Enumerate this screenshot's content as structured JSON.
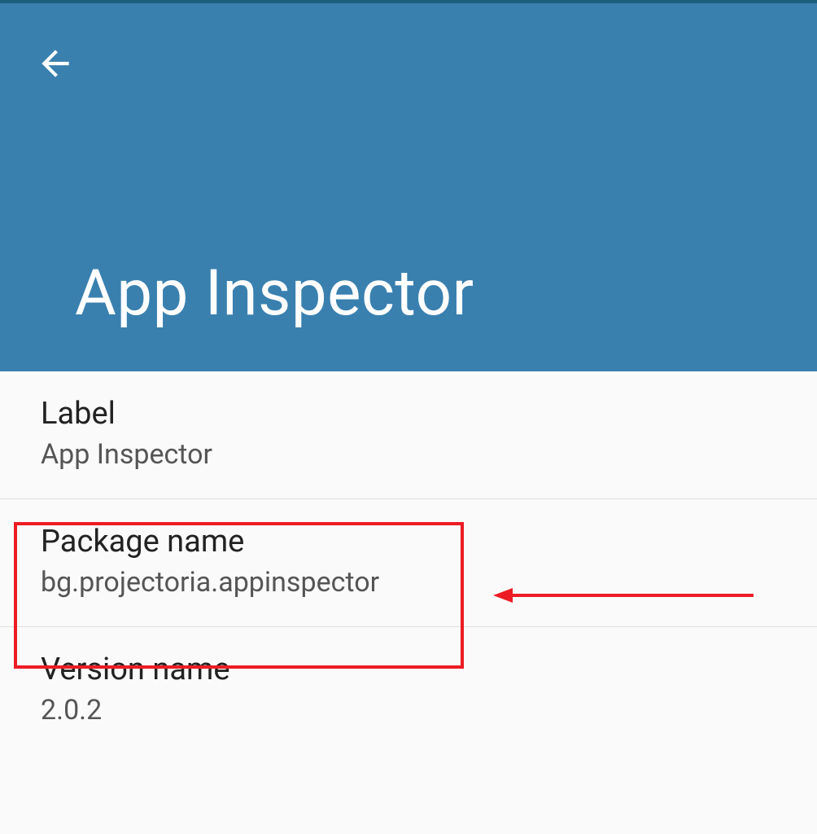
{
  "header": {
    "title": "App Inspector"
  },
  "items": [
    {
      "title": "Label",
      "value": "App Inspector"
    },
    {
      "title": "Package name",
      "value": "bg.projectoria.appinspector"
    },
    {
      "title": "Version name",
      "value": "2.0.2"
    }
  ],
  "colors": {
    "headerBg": "#3980af",
    "annotationRed": "#ed1c24"
  }
}
